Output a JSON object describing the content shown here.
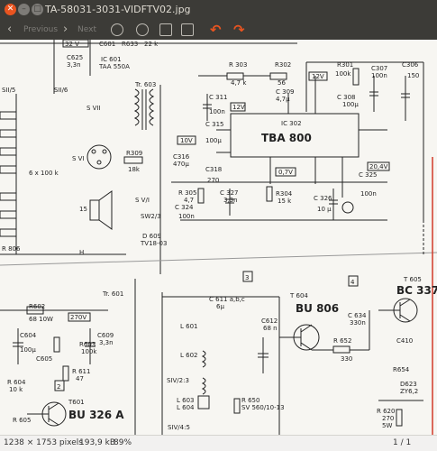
{
  "window": {
    "title": "TA-58031-3031-VIDFTV02.jpg"
  },
  "toolbar": {
    "previous_label": "Previous",
    "next_label": "Next"
  },
  "status": {
    "dimensions": "1238 × 1753 pixels",
    "size": "193,9 kB",
    "zoom": "89%",
    "page": "1 / 1"
  },
  "schematic": {
    "labels": {
      "c625": "C625",
      "c625v": "3,3n",
      "ic601": "IC 601",
      "ic601t": "TAA 550A",
      "c601": "C601",
      "r633": "R633",
      "r633v": "22 k",
      "v3b": "32 V",
      "s115": "SII/5",
      "s116": "SII/6",
      "tr603": "Tr. 603",
      "svii": "S VII",
      "svi": "S VI",
      "r309": "R309",
      "r309v": "18k",
      "sp": "6 x 100 k",
      "r303": "R 303",
      "r303v": "4,7 k",
      "r302": "R302",
      "r302v": "56",
      "c309": "C 309",
      "c309v": "4,7µ",
      "c311": "C 311",
      "c311v": "100n",
      "c315": "C 315",
      "c315v": "100µ",
      "v12": "12V",
      "ic302": "IC 302",
      "tba": "TBA 800",
      "r301": "R301",
      "r301v": "100k",
      "c307": "C307",
      "c307v": "100n",
      "c306": "C306",
      "c306v": "150",
      "c308": "C 308",
      "c308v": "100µ",
      "v12b": "12V",
      "v10": "10V",
      "c316": "C316",
      "c316v": "470µ",
      "c318": "C318",
      "v07": "0,7V",
      "v204": "20,4V",
      "c325": "C 325",
      "c325v": "100n",
      "r305": "R 305",
      "r305v": "4,7",
      "c327": "C 327",
      "c327v": "3,3n",
      "r304": "R304",
      "r304v": "15 k",
      "c326": "C 326",
      "c326v": "10 µ",
      "c324": "C 324",
      "c324v": "100n",
      "v270": "270",
      "sv": "S V/I",
      "sw": "SW2/3",
      "d609": "D 609",
      "tv": "TV18-03",
      "m3": "3",
      "m4": "4",
      "m2": "2",
      "tr601": "Tr. 601",
      "c611": "C 611 a,b,c",
      "c611v": "6µ",
      "t604": "T 604",
      "bu806": "BU 806",
      "t605": "T 605",
      "bc337": "BC 337",
      "l601": "L 601",
      "l602": "L 602",
      "c612": "C612",
      "c612v": "68 n",
      "c634": "C 634",
      "c634v": "330n",
      "r652": "R 652",
      "r652v": "330",
      "s23": "SIV/2:3",
      "s45": "SIV/4:5",
      "l603": "L 603",
      "l604": "L 604",
      "r650": "R 650",
      "r650v": "SV 560/10-13",
      "r654": "R654",
      "d623": "D623",
      "zy": "ZY6,2",
      "r620": "R 620",
      "r620v": "270",
      "r620w": "5W",
      "r602": "R602",
      "r602v": "68 10W",
      "v270b": "270V",
      "c604": "C604",
      "c604v": "100µ",
      "c605": "C605",
      "r603": "R603",
      "r603v": "100k",
      "c609": "C609",
      "c609v": "3,3n",
      "r611": "R 611",
      "r611v": "47",
      "r604": "R 604",
      "r604v": "10 k",
      "r605": "R 605",
      "t601": "T601",
      "bu326": "BU 326 A",
      "h": "H",
      "c410": "C410",
      "r806": "R 806",
      "n15": "15"
    }
  }
}
